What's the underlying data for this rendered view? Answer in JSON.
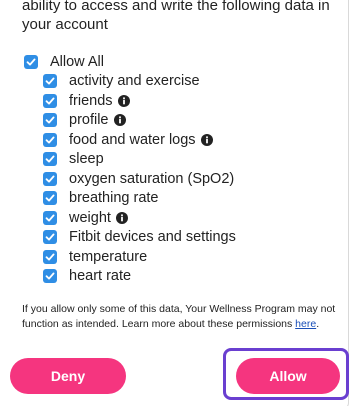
{
  "intro": "ability to access and write the following data in your account",
  "allow_all": "Allow All",
  "permissions": [
    {
      "label": "activity and exercise",
      "info": false
    },
    {
      "label": "friends",
      "info": true
    },
    {
      "label": "profile",
      "info": true
    },
    {
      "label": "food and water logs",
      "info": true
    },
    {
      "label": "sleep",
      "info": false
    },
    {
      "label": "oxygen saturation (SpO2)",
      "info": false
    },
    {
      "label": "breathing rate",
      "info": false
    },
    {
      "label": "weight",
      "info": true
    },
    {
      "label": "Fitbit devices and settings",
      "info": false
    },
    {
      "label": "temperature",
      "info": false
    },
    {
      "label": "heart rate",
      "info": false
    }
  ],
  "note": {
    "text": "If you allow only some of this data, Your Wellness Program may not function as intended. Learn more about these permissions ",
    "link": "here",
    "suffix": "."
  },
  "buttons": {
    "deny": "Deny",
    "allow": "Allow"
  },
  "colors": {
    "checkbox": "#2f8ee5",
    "button": "#f5357f",
    "highlight": "#6a3fd0",
    "link": "#1a4fb8"
  }
}
